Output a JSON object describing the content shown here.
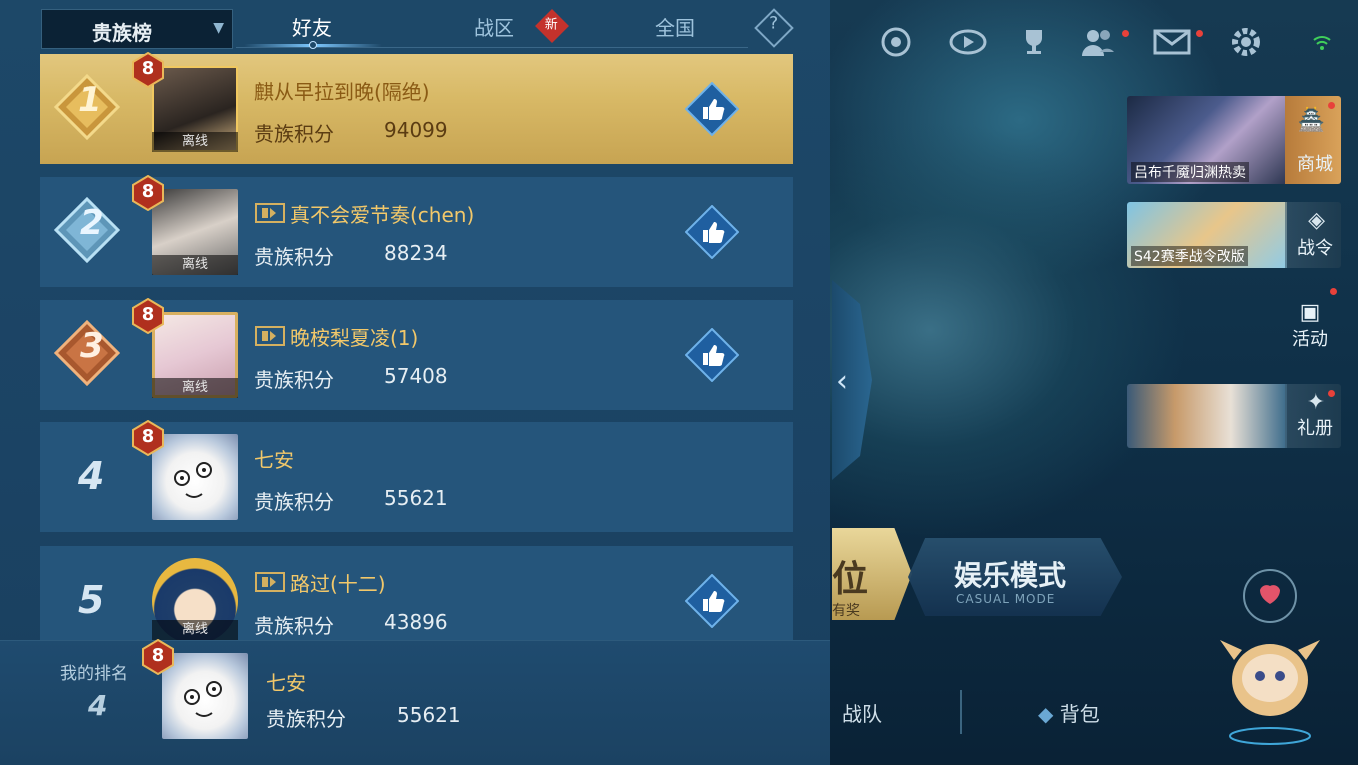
{
  "header": {
    "dropdown_label": "贵族榜",
    "tabs": [
      {
        "label": "好友",
        "active": true
      },
      {
        "label": "战区",
        "badge": "新"
      },
      {
        "label": "全国"
      }
    ],
    "help_icon": "?"
  },
  "points_label": "贵族积分",
  "offline_label": "离线",
  "rows": [
    {
      "rank": "1",
      "level": "8",
      "name": "麒从早拉到晚(隔绝)",
      "points": "94099",
      "offline": true,
      "flag": false
    },
    {
      "rank": "2",
      "level": "8",
      "name": "真不会爱节奏(chen)",
      "points": "88234",
      "offline": true,
      "flag": true
    },
    {
      "rank": "3",
      "level": "8",
      "name": "晚桉梨夏凌(1)",
      "points": "57408",
      "offline": true,
      "flag": true
    },
    {
      "rank": "4",
      "level": "8",
      "name": "七安",
      "points": "55621",
      "offline": false,
      "flag": false
    },
    {
      "rank": "5",
      "level": "",
      "name": "路过(十二)",
      "points": "43896",
      "offline": true,
      "flag": true
    }
  ],
  "my_rank": {
    "label": "我的排名",
    "rank": "4",
    "level": "8",
    "name": "七安",
    "points": "55621"
  },
  "right": {
    "promos": [
      {
        "caption": "吕布千魇归渊热卖",
        "label": "商城"
      },
      {
        "caption": "S42赛季战令改版",
        "label": "战令"
      }
    ],
    "activity_label": "活动",
    "gift_label": "礼册",
    "mode_partial": "位",
    "mode_partial_sub": "有奖",
    "casual_title": "娱乐模式",
    "casual_sub": "CASUAL MODE",
    "bottom": [
      {
        "label": "战队"
      },
      {
        "label": "背包"
      }
    ]
  },
  "colors": {
    "panel": "#1d4868",
    "row": "#25557b",
    "gold_row": "#d8b966",
    "name_gold": "#f2c86a",
    "accent_red": "#c4322c"
  }
}
